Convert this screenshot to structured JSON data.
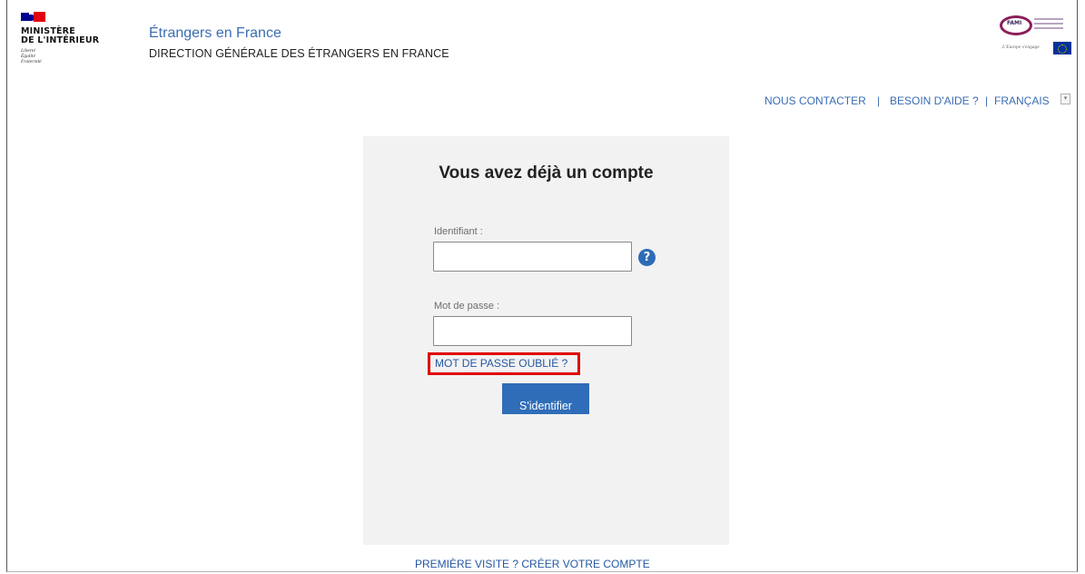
{
  "header": {
    "ministry_name": "MINISTÈRE\nDE L'INTÉRIEUR",
    "ministry_motto": "Liberté\nÉgalité\nFraternité",
    "site_title": "Étrangers en France",
    "site_subtitle": "DIRECTION GÉNÉRALE DES ÉTRANGERS EN FRANCE",
    "fami_logo_text": "FAMI",
    "fami_motto": "L'Europe s'engage"
  },
  "topnav": {
    "contact": "NOUS CONTACTER",
    "help": "BESOIN D'AIDE ?",
    "language": "FRANÇAIS",
    "separator": "|"
  },
  "login": {
    "title": "Vous avez déjà un compte",
    "identifier_label": "Identifiant :",
    "identifier_value": "",
    "password_label": "Mot de passe :",
    "password_value": "",
    "forgot_password": "MOT DE PASSE OUBLIÉ ?",
    "submit": "S'identifier",
    "help_glyph": "?"
  },
  "footer": {
    "first_visit": "PREMIÈRE VISITE ? CRÉER VOTRE COMPTE"
  },
  "colors": {
    "accent_blue": "#3a6db3",
    "button_blue": "#2f6db8",
    "highlight_red": "#e00000",
    "panel_bg": "#f2f2f2"
  },
  "icons": {
    "help": "question-circle-icon",
    "language_dropdown": "chevron-down-icon"
  }
}
